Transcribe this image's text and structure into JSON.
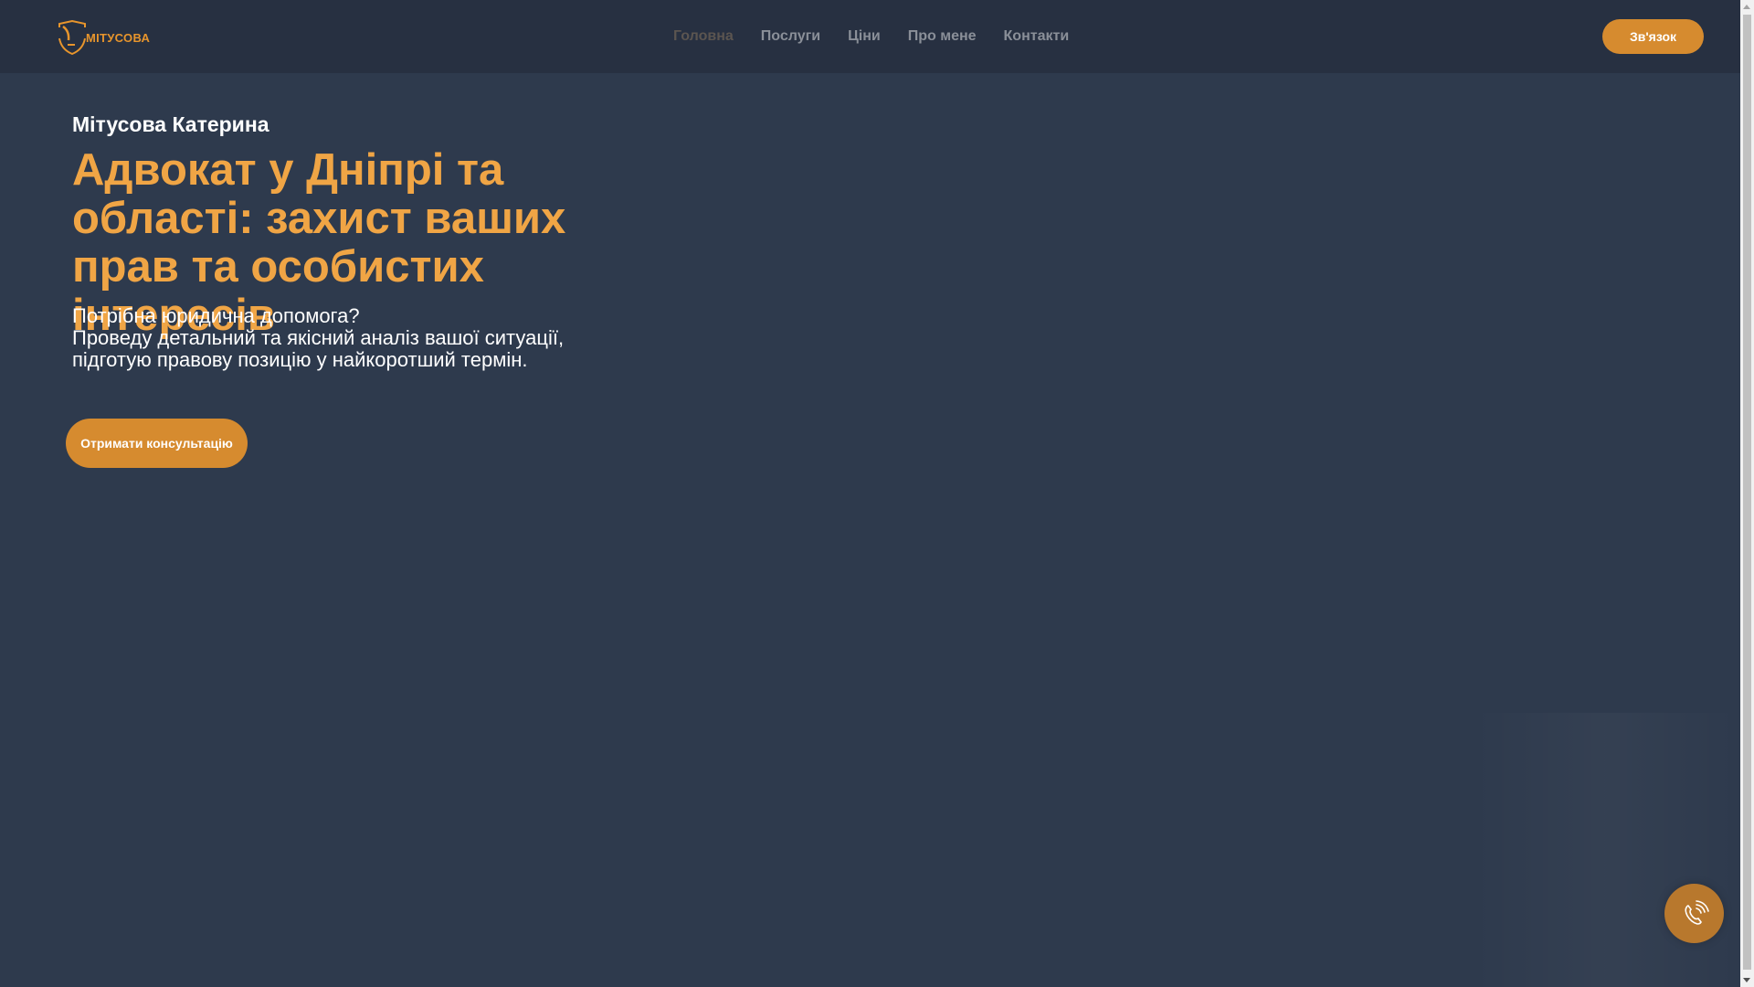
{
  "header": {
    "logo_text": "МІТУСОВА",
    "nav": [
      "Головна",
      "Послуги",
      "Ціни",
      "Про мене",
      "Контакти"
    ],
    "contact_label": "Зв'язок"
  },
  "hero": {
    "name": "Мітусова Катерина",
    "title": "Адвокат у Дніпрі та області: захист ваших прав та особистих інтересів",
    "question": "Потрібна юридична допомога?",
    "line1": "Проведу детальний та якісний аналіз вашої ситуації,",
    "line2": "підготую правову позицію у найкоротший термін.",
    "cta_label": "Отримати консультацію"
  },
  "colors": {
    "accent": "#d68b2f",
    "heading": "#f0a545",
    "background": "#2e3a4d",
    "header": "#273041"
  },
  "icons": {
    "phone": "phone-call-icon"
  }
}
